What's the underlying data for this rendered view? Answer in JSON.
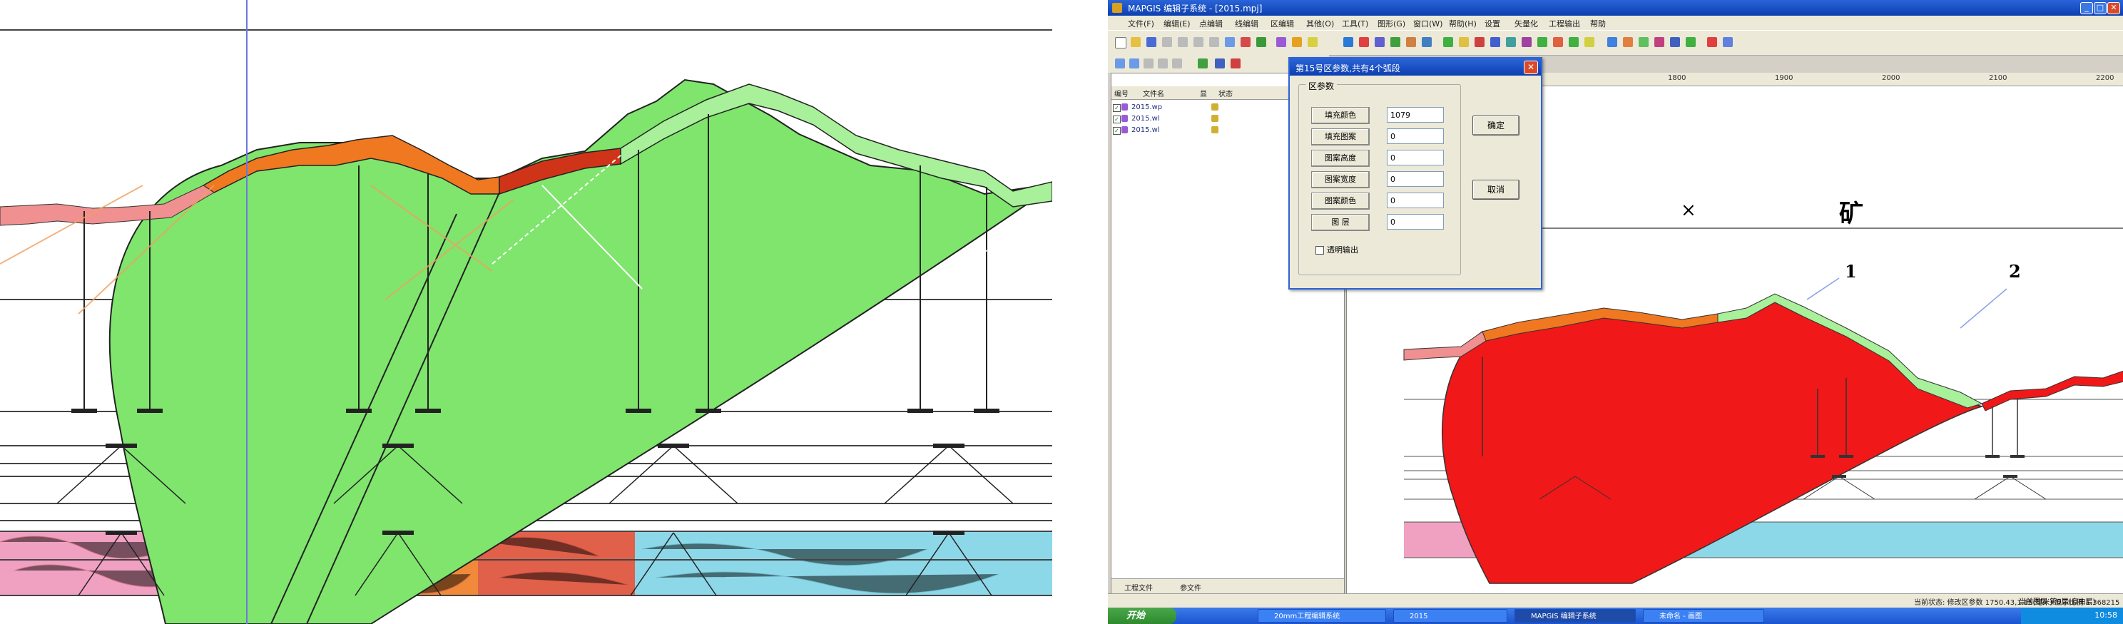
{
  "left_panel": {},
  "window": {
    "title": "MAPGIS 编辑子系统 - [2015.mpj]",
    "menu": [
      "文件(F)",
      "编辑(E)",
      "点编辑",
      "线编辑",
      "区编辑",
      "其他(O)",
      "工具(T)",
      "图形(G)",
      "窗口(W)",
      "帮助(H)",
      "设置",
      "矢量化",
      "工程输出",
      "帮助"
    ],
    "file_panel": {
      "columns": [
        "编号",
        "文件名",
        "显",
        "状态"
      ],
      "files": [
        "2015.wp",
        "2015.wl",
        "2015.wl"
      ],
      "tabs": [
        "工程文件",
        "参文件"
      ]
    },
    "ruler_ticks": [
      "1800",
      "1900",
      "2000",
      "2100",
      "2200"
    ],
    "map_labels": {
      "cross1": "×",
      "cross2": "×",
      "mine": "矿",
      "label1": "1",
      "label2": "2"
    },
    "dialog": {
      "title": "第15号区参数,共有4个弧段",
      "group_title": "区参数",
      "params": [
        {
          "label": "填充颜色",
          "value": "1079"
        },
        {
          "label": "填充图案",
          "value": "0"
        },
        {
          "label": "图案高度",
          "value": "0"
        },
        {
          "label": "图案宽度",
          "value": "0"
        },
        {
          "label": "图案颜色",
          "value": "0"
        },
        {
          "label": "图  层",
          "value": "0"
        }
      ],
      "ok_label": "确定",
      "cancel_label": "取消",
      "transparent_label": "透明输出",
      "close_glyph": "✕"
    },
    "status": {
      "state": "当前状态: 修改区参数 1750.43,1.15(毫米) 显示比例 1.368215",
      "layer": "当前图层 第0层(自由层)"
    },
    "taskbar": {
      "start": "开始",
      "tasks": [
        "20mm工程编辑系统",
        "2015",
        "MAPGIS 编辑子系统",
        "未命名 - 画图"
      ],
      "clock": "10:58"
    },
    "colors": {
      "title_blue": "#2a64d8",
      "fill_green": "#7fe56d",
      "fill_red": "#f01818",
      "orange": "#f07820",
      "pink": "#f09090"
    }
  }
}
